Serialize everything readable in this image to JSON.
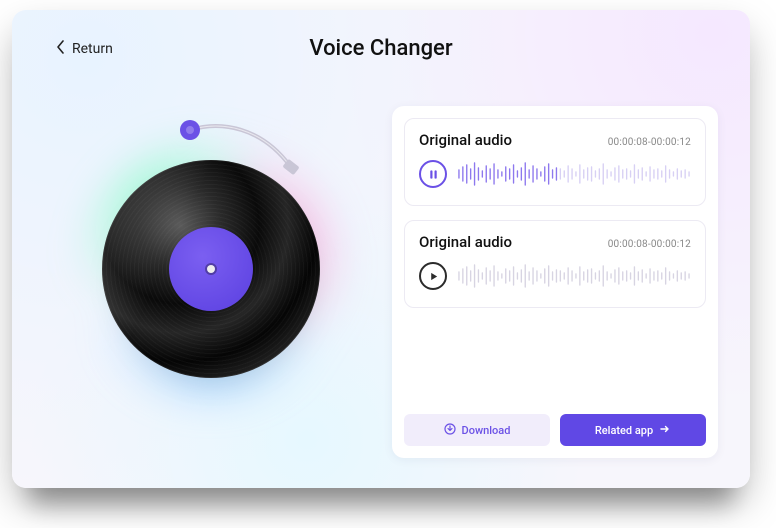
{
  "header": {
    "return_label": "Return",
    "title": "Voice Changer"
  },
  "tracks": [
    {
      "title": "Original audio",
      "time_range": "00:00:08-00:00:12",
      "state": "playing"
    },
    {
      "title": "Original audio",
      "time_range": "00:00:08-00:00:12",
      "state": "paused"
    }
  ],
  "actions": {
    "download_label": "Download",
    "related_label": "Related app"
  },
  "colors": {
    "accent": "#6b51e6",
    "solid_button": "#6048e5",
    "ghost_button_bg": "#f1edfb"
  }
}
